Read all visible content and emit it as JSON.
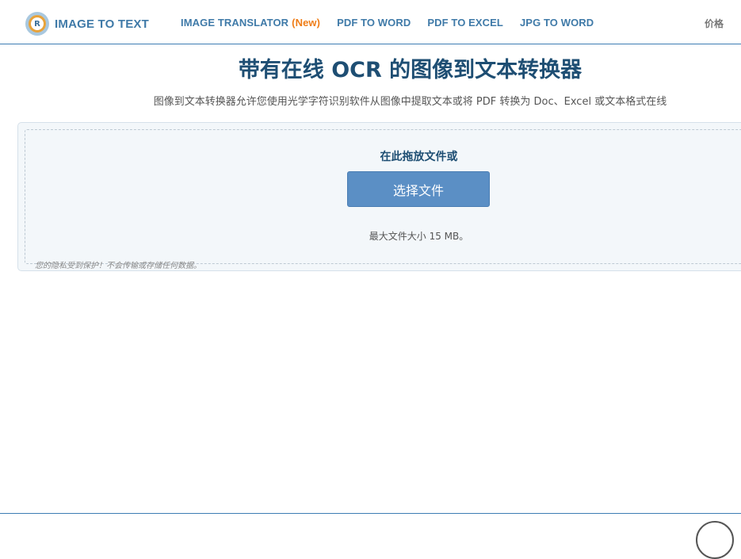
{
  "header": {
    "logo_text": "IMAGE TO TEXT",
    "logo_mark": "R",
    "nav": [
      {
        "label": "IMAGE TRANSLATOR",
        "badge": "(New)"
      },
      {
        "label": "PDF TO WORD"
      },
      {
        "label": "PDF TO EXCEL"
      },
      {
        "label": "JPG TO WORD"
      }
    ],
    "pricing": "价格"
  },
  "main": {
    "title": "带有在线 OCR 的图像到文本转换器",
    "subtitle": "图像到文本转换器允许您使用光学字符识别软件从图像中提取文本或将 PDF 转换为 Doc、Excel 或文本格式在线"
  },
  "upload": {
    "drop_label": "在此拖放文件或",
    "choose_button": "选择文件",
    "max_size": "最大文件大小 15 MB。",
    "privacy": "您的隐私受到保护！不会传输或存储任何数据。"
  },
  "colors": {
    "brand": "#3f7aa8",
    "accent_new": "#ef7d17",
    "title": "#1e4e73",
    "button": "#5b8fc5"
  }
}
